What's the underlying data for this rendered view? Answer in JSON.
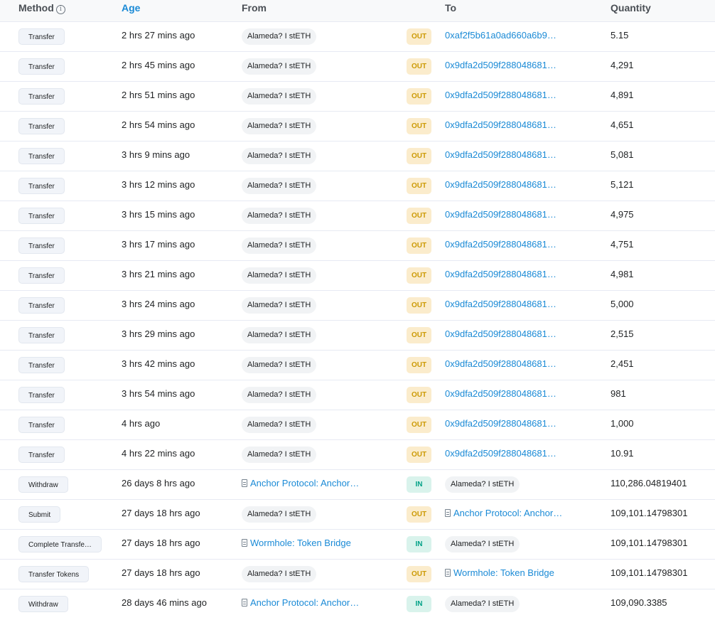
{
  "header": {
    "method": "Method",
    "age": "Age",
    "from": "From",
    "to": "To",
    "quantity": "Quantity",
    "info_icon": "i"
  },
  "colors": {
    "link": "#1a8ad6",
    "out_bg": "#fbeccc",
    "out_text": "#cc9a06",
    "in_bg": "#d9f3ec",
    "in_text": "#00a186"
  },
  "rows": [
    {
      "method": "Transfer",
      "age": "2 hrs 27 mins ago",
      "from": {
        "type": "pill",
        "text": "Alameda? I stETH"
      },
      "direction": "OUT",
      "to": {
        "type": "link",
        "text": "0xaf2f5b61a0ad660a6b9…"
      },
      "quantity": "5.15"
    },
    {
      "method": "Transfer",
      "age": "2 hrs 45 mins ago",
      "from": {
        "type": "pill",
        "text": "Alameda? I stETH"
      },
      "direction": "OUT",
      "to": {
        "type": "link",
        "text": "0x9dfa2d509f288048681…"
      },
      "quantity": "4,291"
    },
    {
      "method": "Transfer",
      "age": "2 hrs 51 mins ago",
      "from": {
        "type": "pill",
        "text": "Alameda? I stETH"
      },
      "direction": "OUT",
      "to": {
        "type": "link",
        "text": "0x9dfa2d509f288048681…"
      },
      "quantity": "4,891"
    },
    {
      "method": "Transfer",
      "age": "2 hrs 54 mins ago",
      "from": {
        "type": "pill",
        "text": "Alameda? I stETH"
      },
      "direction": "OUT",
      "to": {
        "type": "link",
        "text": "0x9dfa2d509f288048681…"
      },
      "quantity": "4,651"
    },
    {
      "method": "Transfer",
      "age": "3 hrs 9 mins ago",
      "from": {
        "type": "pill",
        "text": "Alameda? I stETH"
      },
      "direction": "OUT",
      "to": {
        "type": "link",
        "text": "0x9dfa2d509f288048681…"
      },
      "quantity": "5,081"
    },
    {
      "method": "Transfer",
      "age": "3 hrs 12 mins ago",
      "from": {
        "type": "pill",
        "text": "Alameda? I stETH"
      },
      "direction": "OUT",
      "to": {
        "type": "link",
        "text": "0x9dfa2d509f288048681…"
      },
      "quantity": "5,121"
    },
    {
      "method": "Transfer",
      "age": "3 hrs 15 mins ago",
      "from": {
        "type": "pill",
        "text": "Alameda? I stETH"
      },
      "direction": "OUT",
      "to": {
        "type": "link",
        "text": "0x9dfa2d509f288048681…"
      },
      "quantity": "4,975"
    },
    {
      "method": "Transfer",
      "age": "3 hrs 17 mins ago",
      "from": {
        "type": "pill",
        "text": "Alameda? I stETH"
      },
      "direction": "OUT",
      "to": {
        "type": "link",
        "text": "0x9dfa2d509f288048681…"
      },
      "quantity": "4,751"
    },
    {
      "method": "Transfer",
      "age": "3 hrs 21 mins ago",
      "from": {
        "type": "pill",
        "text": "Alameda? I stETH"
      },
      "direction": "OUT",
      "to": {
        "type": "link",
        "text": "0x9dfa2d509f288048681…"
      },
      "quantity": "4,981"
    },
    {
      "method": "Transfer",
      "age": "3 hrs 24 mins ago",
      "from": {
        "type": "pill",
        "text": "Alameda? I stETH"
      },
      "direction": "OUT",
      "to": {
        "type": "link",
        "text": "0x9dfa2d509f288048681…"
      },
      "quantity": "5,000"
    },
    {
      "method": "Transfer",
      "age": "3 hrs 29 mins ago",
      "from": {
        "type": "pill",
        "text": "Alameda? I stETH"
      },
      "direction": "OUT",
      "to": {
        "type": "link",
        "text": "0x9dfa2d509f288048681…"
      },
      "quantity": "2,515"
    },
    {
      "method": "Transfer",
      "age": "3 hrs 42 mins ago",
      "from": {
        "type": "pill",
        "text": "Alameda? I stETH"
      },
      "direction": "OUT",
      "to": {
        "type": "link",
        "text": "0x9dfa2d509f288048681…"
      },
      "quantity": "2,451"
    },
    {
      "method": "Transfer",
      "age": "3 hrs 54 mins ago",
      "from": {
        "type": "pill",
        "text": "Alameda? I stETH"
      },
      "direction": "OUT",
      "to": {
        "type": "link",
        "text": "0x9dfa2d509f288048681…"
      },
      "quantity": "981"
    },
    {
      "method": "Transfer",
      "age": "4 hrs ago",
      "from": {
        "type": "pill",
        "text": "Alameda? I stETH"
      },
      "direction": "OUT",
      "to": {
        "type": "link",
        "text": "0x9dfa2d509f288048681…"
      },
      "quantity": "1,000"
    },
    {
      "method": "Transfer",
      "age": "4 hrs 22 mins ago",
      "from": {
        "type": "pill",
        "text": "Alameda? I stETH"
      },
      "direction": "OUT",
      "to": {
        "type": "link",
        "text": "0x9dfa2d509f288048681…"
      },
      "quantity": "10.91"
    },
    {
      "method": "Withdraw",
      "age": "26 days 8 hrs ago",
      "from": {
        "type": "contract",
        "text": "Anchor Protocol: Anchor…"
      },
      "direction": "IN",
      "to": {
        "type": "pill",
        "text": "Alameda? I stETH"
      },
      "quantity": "110,286.04819401"
    },
    {
      "method": "Submit",
      "age": "27 days 18 hrs ago",
      "from": {
        "type": "pill",
        "text": "Alameda? I stETH"
      },
      "direction": "OUT",
      "to": {
        "type": "contract",
        "text": "Anchor Protocol: Anchor…"
      },
      "quantity": "109,101.14798301"
    },
    {
      "method": "Complete Transfe…",
      "age": "27 days 18 hrs ago",
      "from": {
        "type": "contract",
        "text": "Wormhole: Token Bridge"
      },
      "direction": "IN",
      "to": {
        "type": "pill",
        "text": "Alameda? I stETH"
      },
      "quantity": "109,101.14798301"
    },
    {
      "method": "Transfer Tokens",
      "age": "27 days 18 hrs ago",
      "from": {
        "type": "pill",
        "text": "Alameda? I stETH"
      },
      "direction": "OUT",
      "to": {
        "type": "contract",
        "text": "Wormhole: Token Bridge"
      },
      "quantity": "109,101.14798301"
    },
    {
      "method": "Withdraw",
      "age": "28 days 46 mins ago",
      "from": {
        "type": "contract",
        "text": "Anchor Protocol: Anchor…"
      },
      "direction": "IN",
      "to": {
        "type": "pill",
        "text": "Alameda? I stETH"
      },
      "quantity": "109,090.3385"
    }
  ]
}
